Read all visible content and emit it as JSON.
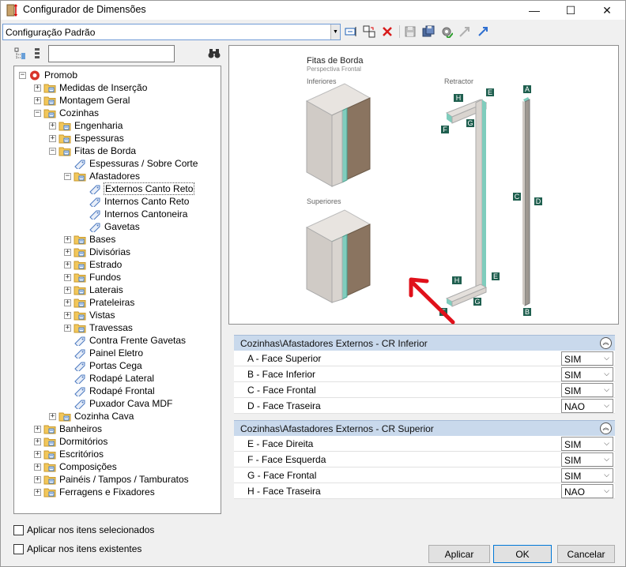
{
  "window": {
    "title": "Configurador de Dimensões",
    "minimize": "—",
    "maximize": "☐",
    "close": "✕"
  },
  "toolbar": {
    "config_value": "Configuração Padrão"
  },
  "tree": {
    "rows": [
      {
        "label": "Promob",
        "level": 0,
        "exp": "−",
        "kind": "root"
      },
      {
        "label": "Medidas de Inserção",
        "level": 1,
        "exp": "+",
        "kind": "folder"
      },
      {
        "label": "Montagem Geral",
        "level": 1,
        "exp": "+",
        "kind": "folder"
      },
      {
        "label": "Cozinhas",
        "level": 1,
        "exp": "−",
        "kind": "folder"
      },
      {
        "label": "Engenharia",
        "level": 2,
        "exp": "+",
        "kind": "folder"
      },
      {
        "label": "Espessuras",
        "level": 2,
        "exp": "+",
        "kind": "folder"
      },
      {
        "label": "Fitas de Borda",
        "level": 2,
        "exp": "−",
        "kind": "folder"
      },
      {
        "label": "Espessuras / Sobre Corte",
        "level": 3,
        "exp": "",
        "kind": "tag"
      },
      {
        "label": "Afastadores",
        "level": 3,
        "exp": "−",
        "kind": "folder"
      },
      {
        "label": "Externos Canto Reto",
        "level": 4,
        "exp": "",
        "kind": "tag",
        "selected": true
      },
      {
        "label": "Internos Canto Reto",
        "level": 4,
        "exp": "",
        "kind": "tag"
      },
      {
        "label": "Internos Cantoneira",
        "level": 4,
        "exp": "",
        "kind": "tag"
      },
      {
        "label": "Gavetas",
        "level": 4,
        "exp": "",
        "kind": "tag"
      },
      {
        "label": "Bases",
        "level": 3,
        "exp": "+",
        "kind": "folder"
      },
      {
        "label": "Divisórias",
        "level": 3,
        "exp": "+",
        "kind": "folder"
      },
      {
        "label": "Estrado",
        "level": 3,
        "exp": "+",
        "kind": "folder"
      },
      {
        "label": "Fundos",
        "level": 3,
        "exp": "+",
        "kind": "folder"
      },
      {
        "label": "Laterais",
        "level": 3,
        "exp": "+",
        "kind": "folder"
      },
      {
        "label": "Prateleiras",
        "level": 3,
        "exp": "+",
        "kind": "folder"
      },
      {
        "label": "Vistas",
        "level": 3,
        "exp": "+",
        "kind": "folder"
      },
      {
        "label": "Travessas",
        "level": 3,
        "exp": "+",
        "kind": "folder"
      },
      {
        "label": "Contra Frente Gavetas",
        "level": 3,
        "exp": "",
        "kind": "tag"
      },
      {
        "label": "Painel Eletro",
        "level": 3,
        "exp": "",
        "kind": "tag"
      },
      {
        "label": "Portas Cega",
        "level": 3,
        "exp": "",
        "kind": "tag"
      },
      {
        "label": "Rodapé Lateral",
        "level": 3,
        "exp": "",
        "kind": "tag"
      },
      {
        "label": "Rodapé Frontal",
        "level": 3,
        "exp": "",
        "kind": "tag"
      },
      {
        "label": "Puxador Cava MDF",
        "level": 3,
        "exp": "",
        "kind": "tag"
      },
      {
        "label": "Cozinha Cava",
        "level": 2,
        "exp": "+",
        "kind": "folder"
      },
      {
        "label": "Banheiros",
        "level": 1,
        "exp": "+",
        "kind": "folder"
      },
      {
        "label": "Dormitórios",
        "level": 1,
        "exp": "+",
        "kind": "folder"
      },
      {
        "label": "Escritórios",
        "level": 1,
        "exp": "+",
        "kind": "folder"
      },
      {
        "label": "Composições",
        "level": 1,
        "exp": "+",
        "kind": "folder"
      },
      {
        "label": "Painéis / Tampos / Tamburatos",
        "level": 1,
        "exp": "+",
        "kind": "folder"
      },
      {
        "label": "Ferragens e Fixadores",
        "level": 1,
        "exp": "+",
        "kind": "folder"
      }
    ]
  },
  "checks": {
    "apply_selected": "Aplicar nos itens selecionados",
    "apply_existing": "Aplicar nos itens existentes"
  },
  "preview": {
    "title": "Fitas de Borda",
    "subtitle": "Perspectiva Frontal",
    "inferiores": "Inferiores",
    "superiores": "Superiores",
    "retractor": "Retractor",
    "letters": {
      "a": "A",
      "b": "B",
      "c": "C",
      "d": "D",
      "e": "E",
      "f": "F",
      "g": "G",
      "h": "H"
    }
  },
  "groups": [
    {
      "title": "Cozinhas\\Afastadores Externos - CR Inferior",
      "rows": [
        {
          "label": "A - Face Superior",
          "value": "SIM"
        },
        {
          "label": "B - Face Inferior",
          "value": "SIM"
        },
        {
          "label": "C - Face Frontal",
          "value": "SIM"
        },
        {
          "label": "D - Face Traseira",
          "value": "NAO"
        }
      ]
    },
    {
      "title": "Cozinhas\\Afastadores Externos - CR Superior",
      "rows": [
        {
          "label": "E - Face Direita",
          "value": "SIM"
        },
        {
          "label": "F - Face Esquerda",
          "value": "SIM"
        },
        {
          "label": "G - Face Frontal",
          "value": "SIM"
        },
        {
          "label": "H - Face Traseira",
          "value": "NAO"
        }
      ]
    }
  ],
  "buttons": {
    "apply": "Aplicar",
    "ok": "OK",
    "cancel": "Cancelar"
  },
  "colors": {
    "edge_band": "#7fcdbd",
    "panel": "#d9d4cf",
    "wood": "#8a7460",
    "header_bg": "#c9d9ec",
    "arrow": "#e0101a",
    "letter_box": "#1f5f4f"
  }
}
